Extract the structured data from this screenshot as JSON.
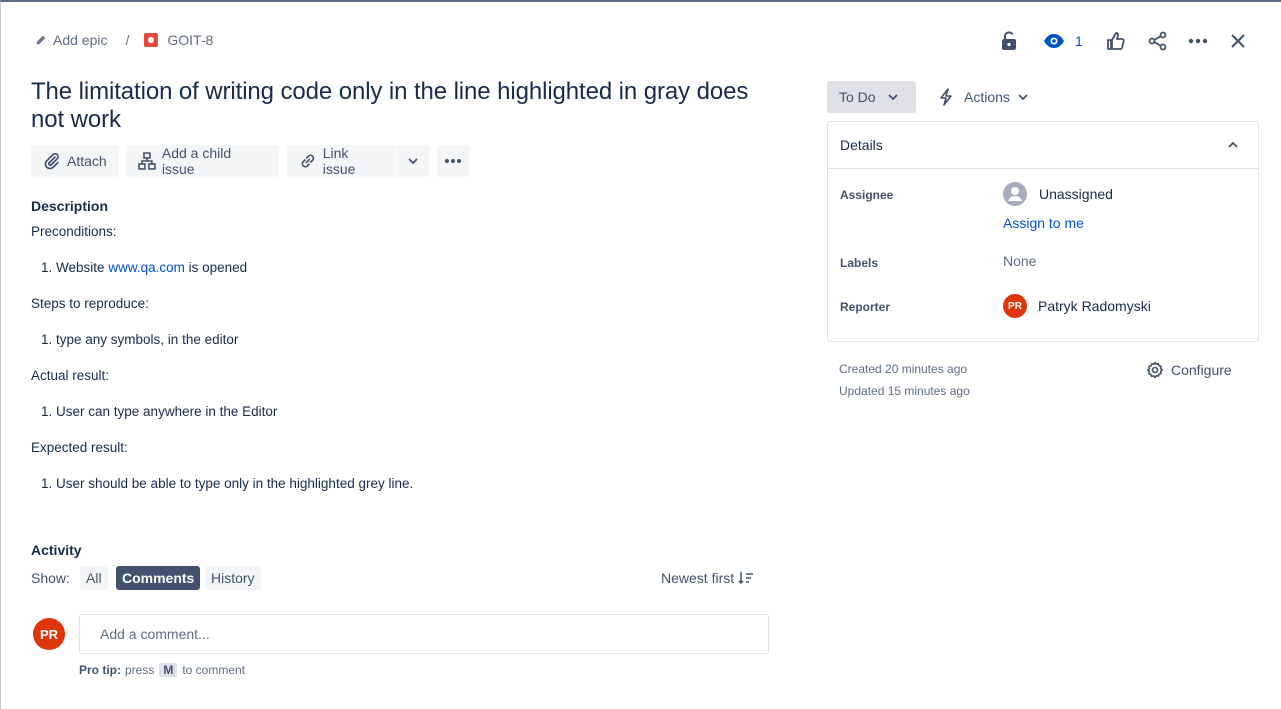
{
  "breadcrumb": {
    "add_epic": "Add epic",
    "separator": "/",
    "issue_key": "GOIT-8"
  },
  "header_actions": {
    "watch_count": "1",
    "icons": [
      "lock-icon",
      "watch-eye-icon",
      "like-icon",
      "share-icon",
      "more-icon",
      "close-icon"
    ]
  },
  "issue": {
    "title": "The limitation of writing code only in the line highlighted in gray does not work"
  },
  "toolbar": {
    "attach": "Attach",
    "add_child": "Add a child issue",
    "link_issue": "Link issue"
  },
  "description": {
    "heading": "Description",
    "preconditions": "Preconditions:",
    "pre_item_num": "1.",
    "pre_item_prefix": "Website",
    "pre_item_link": "www.qa.com",
    "pre_item_suffix": "is opened",
    "steps": "Steps to reproduce:",
    "steps_item": "1. type any symbols, in the editor",
    "actual": "Actual result:",
    "actual_item": "1. User can type anywhere in the Editor",
    "expected": "Expected result:",
    "expected_item": "1. User should be able to type only in the highlighted grey line."
  },
  "activity": {
    "heading": "Activity",
    "show_label": "Show:",
    "filters": [
      "All",
      "Comments",
      "History"
    ],
    "active_filter": "Comments",
    "sort": "Newest first",
    "user_initials": "PR",
    "comment_placeholder": "Add a comment...",
    "protip_bold": "Pro tip:",
    "protip_press": "press",
    "protip_key": "M",
    "protip_rest": "to comment"
  },
  "status": {
    "current": "To Do",
    "actions": "Actions"
  },
  "details": {
    "heading": "Details",
    "assignee_label": "Assignee",
    "assignee_value": "Unassigned",
    "assign_to_me": "Assign to me",
    "labels_label": "Labels",
    "labels_value": "None",
    "reporter_label": "Reporter",
    "reporter_initials": "PR",
    "reporter_name": "Patryk Radomyski"
  },
  "meta": {
    "created": "Created 20 minutes ago",
    "updated": "Updated 15 minutes ago",
    "configure": "Configure"
  },
  "colors": {
    "link": "#0052cc",
    "avatar": "#de350b",
    "issue_type": "#e5493a",
    "text": "#172b4d"
  }
}
